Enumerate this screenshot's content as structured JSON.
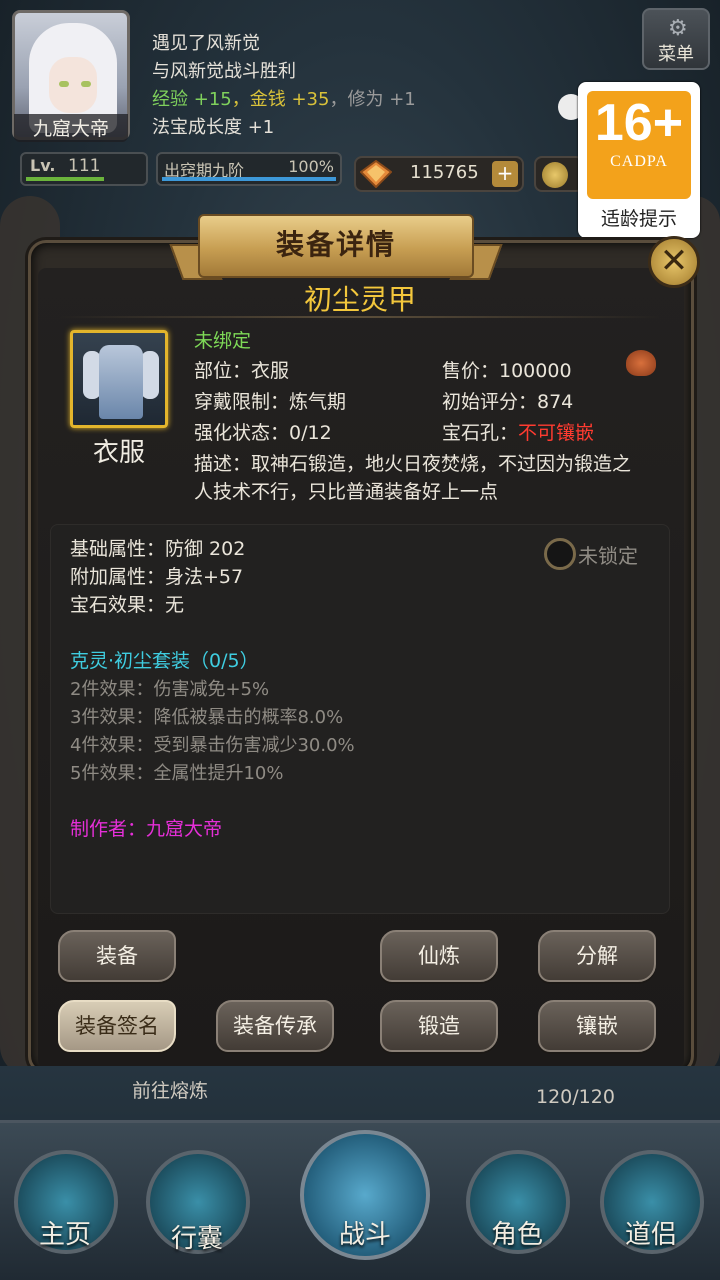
{
  "top": {
    "player_name": "九窟大帝",
    "log": [
      "遇见了风新觉",
      "与风新觉战斗胜利"
    ],
    "reward": {
      "exp_label": "经验",
      "exp_value": "+15",
      "sep1": "，",
      "money_label": "金钱",
      "money_value": "+35",
      "sep2": "，",
      "cultivate_label": "修为",
      "cultivate_value": "+1"
    },
    "treasure_growth": "法宝成长度 +1",
    "menu_label": "菜单",
    "level_label": "Lv.",
    "level_value": "111",
    "level_progress": 0.7,
    "stage_label": "出窍期九阶",
    "stage_pct": "100%",
    "stage_progress": 1.0,
    "spirit_stones": "115765",
    "plus_label": "+"
  },
  "cadpa": {
    "age": "16+",
    "org": "CADPA",
    "tip": "适龄提示"
  },
  "panel": {
    "banner_title": "装备详情",
    "item_name": "初尘灵甲",
    "item_type": "衣服",
    "binding": "未绑定",
    "slot": "部位：衣服",
    "price": "售价：100000",
    "requirement": "穿戴限制：炼气期",
    "initial_score": "初始评分：874",
    "enhance": "强化状态：0/12",
    "gem_slot_label": "宝石孔：",
    "gem_slot_value": "不可镶嵌",
    "desc_line1": "描述：取神石锻造，地火日夜焚烧，不过因为锻造之",
    "desc_line2": "人技术不行，只比普通装备好上一点",
    "base_attr": "基础属性：防御 202",
    "extra_attr": "附加属性：身法+57",
    "gem_effect": "宝石效果：无",
    "lock_label": "未锁定",
    "set_title": "克灵·初尘套装（0/5）",
    "set_effects": [
      "2件效果：伤害减免+5%",
      "3件效果：降低被暴击的概率8.0%",
      "4件效果：受到暴击伤害减少30.0%",
      "5件效果：全属性提升10%"
    ],
    "maker": "制作者：九窟大帝",
    "buttons": {
      "equip": "装备",
      "refine": "仙炼",
      "decompose": "分解",
      "sign": "装备签名",
      "inherit": "装备传承",
      "forge": "锻造",
      "inlay": "镶嵌"
    }
  },
  "bottom": {
    "goto_smelt": "前往熔炼",
    "bag_capacity": "120/120",
    "nav": [
      "主页",
      "行囊",
      "战斗",
      "角色",
      "道侣"
    ]
  }
}
